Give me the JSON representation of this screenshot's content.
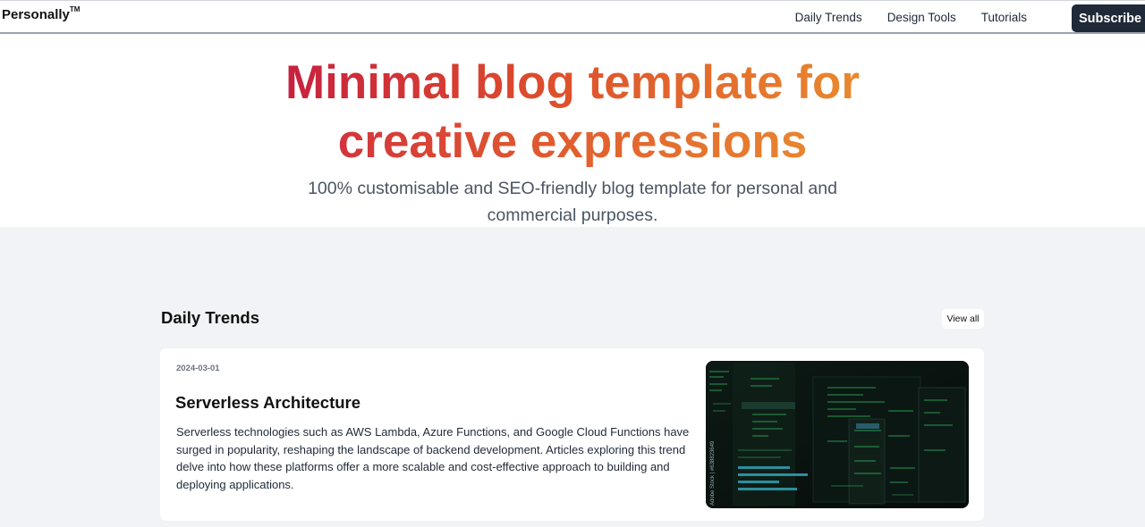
{
  "nav": {
    "brand": "Personally",
    "brand_mark": "TM",
    "links": [
      "Daily Trends",
      "Design Tools",
      "Tutorials"
    ],
    "subscribe_label": "Subscribe"
  },
  "hero": {
    "title_line1": "Minimal blog template for",
    "title_line2": "creative expressions",
    "subtitle": "100% customisable and SEO-friendly blog template for personal and commercial purposes."
  },
  "section": {
    "title": "Daily Trends",
    "view_all_label": "View all"
  },
  "post": {
    "date": "2024-03-01",
    "title": "Serverless Architecture",
    "excerpt": "Serverless technologies such as AWS Lambda, Azure Functions, and Google Cloud Functions have surged in popularity, reshaping the landscape of backend development. Articles exploring this trend delve into how these platforms offer a more scalable and cost-effective approach to building and deploying applications.",
    "image_watermark": "Adobe Stock | #638823649"
  },
  "colors": {
    "gradient_start": "#c8203f",
    "gradient_end": "#e9892e",
    "subscribe_bg": "#1f2937",
    "section_bg": "#f2f3f6"
  }
}
